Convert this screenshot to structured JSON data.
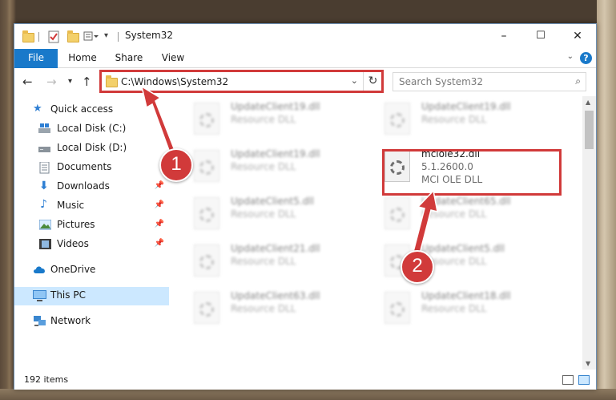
{
  "window": {
    "title": "System32",
    "controls": {
      "minimize": "–",
      "maximize": "☐",
      "close": "✕"
    }
  },
  "ribbon": {
    "tabs": [
      {
        "label": "File"
      },
      {
        "label": "Home"
      },
      {
        "label": "Share"
      },
      {
        "label": "View"
      }
    ],
    "help": "?"
  },
  "navigation": {
    "address": "C:\\Windows\\System32",
    "search_placeholder": "Search System32"
  },
  "sidebar": {
    "items": [
      {
        "label": "Quick access"
      },
      {
        "label": "Local Disk (C:)"
      },
      {
        "label": "Local Disk (D:)"
      },
      {
        "label": "Documents"
      },
      {
        "label": "Downloads"
      },
      {
        "label": "Music"
      },
      {
        "label": "Pictures"
      },
      {
        "label": "Videos"
      },
      {
        "label": "OneDrive"
      },
      {
        "label": "This PC"
      },
      {
        "label": "Network"
      }
    ]
  },
  "files": {
    "left_column": [
      {
        "name": "UpdateClient19.dll",
        "type": "Resource DLL"
      },
      {
        "name": "UpdateClient19.dll",
        "type": "Resource DLL"
      },
      {
        "name": "UpdateClient5.dll",
        "type": "Resource DLL"
      },
      {
        "name": "UpdateClient21.dll",
        "type": "Resource DLL"
      },
      {
        "name": "UpdateClient63.dll",
        "type": "Resource DLL"
      }
    ],
    "right_column": [
      {
        "name": "UpdateClient19.dll",
        "type": "Resource DLL"
      },
      {
        "name": "UpdateClient65.dll",
        "type": "Resource DLL"
      },
      {
        "name": "UpdateClient5.dll",
        "type": "Resource DLL"
      },
      {
        "name": "UpdateClient18.dll",
        "type": "Resource DLL"
      }
    ],
    "highlighted": {
      "name": "mciole32.dll",
      "version": "5.1.2600.0",
      "description": "MCI OLE DLL"
    }
  },
  "status": {
    "item_count": "192 items"
  },
  "annotations": {
    "step1": "1",
    "step2": "2"
  },
  "colors": {
    "accent": "#1979ca",
    "highlight": "#d13a3a",
    "selected": "#cce8ff"
  }
}
